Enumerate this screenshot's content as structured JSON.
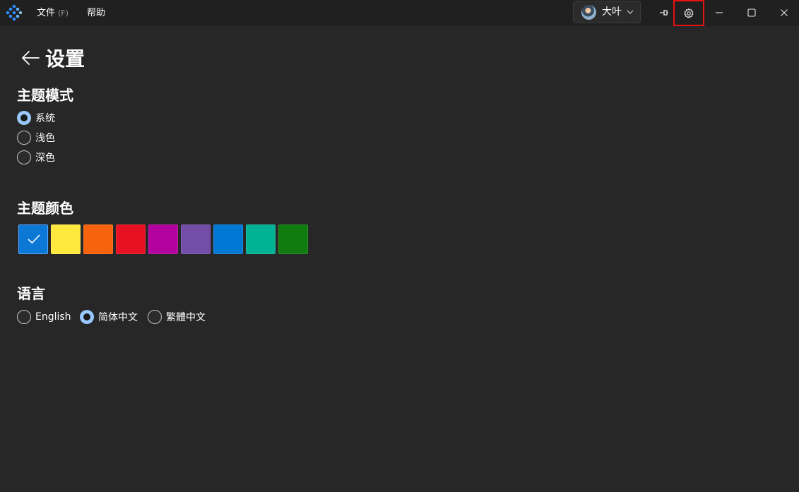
{
  "menu": {
    "file_label": "文件",
    "file_mnemonic": "(F)",
    "help_label": "帮助"
  },
  "user": {
    "name": "大叶"
  },
  "icons": {
    "app_logo": "app-logo-icon",
    "pin": "pin-icon",
    "settings": "gear-icon",
    "minimize": "minimize-icon",
    "maximize": "maximize-icon",
    "close": "close-icon",
    "back": "back-arrow-icon",
    "check": "check-icon",
    "chevron": "chevron-down-icon"
  },
  "page": {
    "title": "设置"
  },
  "theme_mode": {
    "title": "主题模式",
    "options": [
      {
        "label": "系统",
        "checked": true
      },
      {
        "label": "浅色",
        "checked": false
      },
      {
        "label": "深色",
        "checked": false
      }
    ]
  },
  "theme_color": {
    "title": "主题颜色",
    "swatches": [
      {
        "color": "#0a78d4",
        "selected": true
      },
      {
        "color": "#ffe83e",
        "selected": false
      },
      {
        "color": "#f7630c",
        "selected": false
      },
      {
        "color": "#e81123",
        "selected": false
      },
      {
        "color": "#b4009e",
        "selected": false
      },
      {
        "color": "#744da9",
        "selected": false
      },
      {
        "color": "#0078d4",
        "selected": false
      },
      {
        "color": "#00b294",
        "selected": false
      },
      {
        "color": "#107c10",
        "selected": false
      }
    ]
  },
  "language": {
    "title": "语言",
    "options": [
      {
        "label": "English",
        "checked": false
      },
      {
        "label": "简体中文",
        "checked": true
      },
      {
        "label": "繁體中文",
        "checked": false
      }
    ]
  },
  "colors": {
    "background": "#272727",
    "titlebar": "#202020",
    "accent": "#99c8ff",
    "highlight_border": "#e81010"
  }
}
